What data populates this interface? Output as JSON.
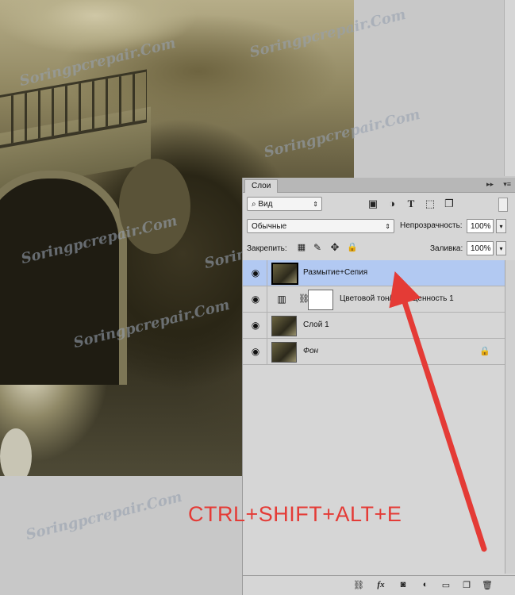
{
  "watermark": "Soringpcrepair.Com",
  "panel": {
    "tab_label": "Слои",
    "filter_label": "Вид",
    "blend_mode": "Обычные",
    "opacity_label": "Непрозрачность:",
    "opacity_value": "100%",
    "lock_label": "Закрепить:",
    "fill_label": "Заливка:",
    "fill_value": "100%",
    "layers": [
      {
        "name": "Размытие+Сепия",
        "selected": true
      },
      {
        "name": "Цветовой тон/Насыщенность 1",
        "type": "adjustment"
      },
      {
        "name": "Слой 1"
      },
      {
        "name": "Фон",
        "italic": true,
        "locked": true
      }
    ]
  },
  "annotation": {
    "hotkey_text": "CTRL+SHIFT+ALT+E",
    "color": "#e43b36"
  }
}
